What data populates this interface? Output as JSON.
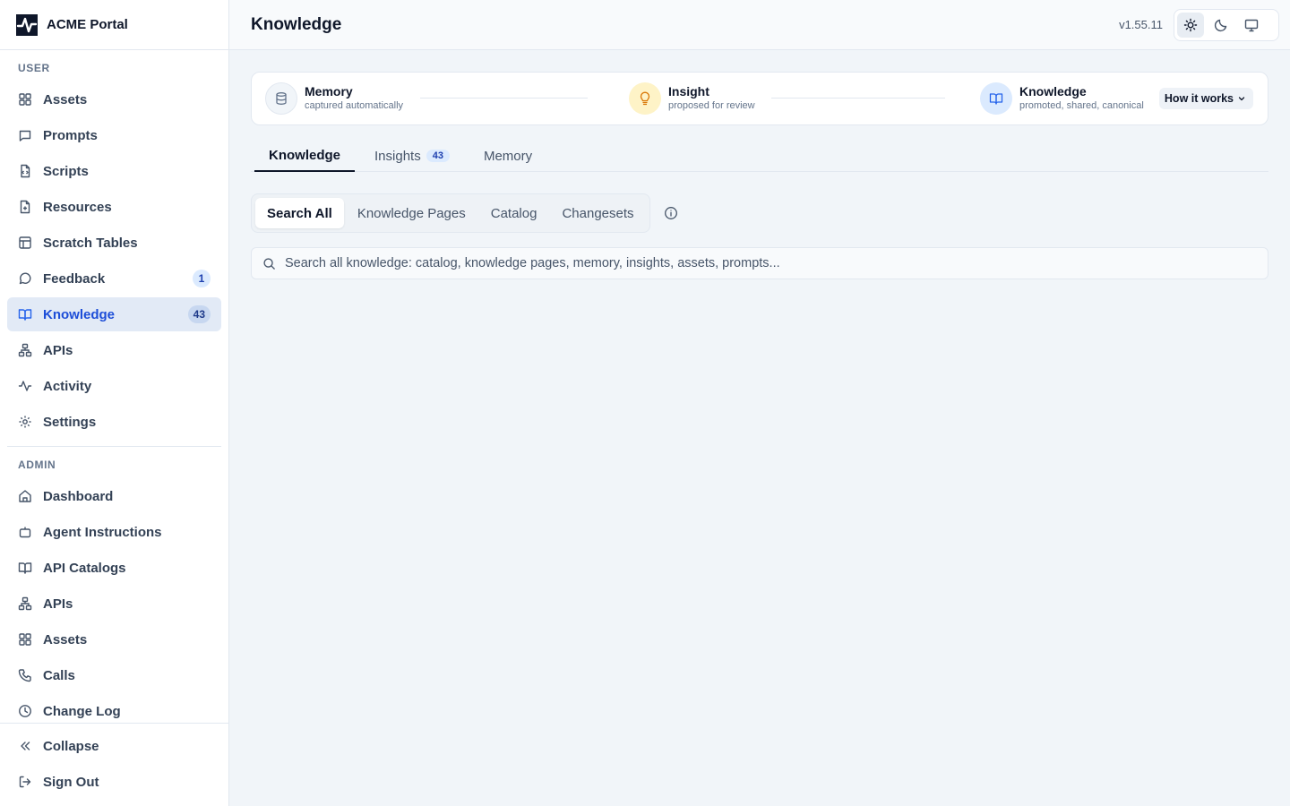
{
  "app": {
    "name": "ACME Portal"
  },
  "sidebar": {
    "user_title": "USER",
    "admin_title": "ADMIN",
    "user_items": [
      {
        "label": "Assets",
        "icon": "grid-icon"
      },
      {
        "label": "Prompts",
        "icon": "message-square-icon"
      },
      {
        "label": "Scripts",
        "icon": "file-code-icon"
      },
      {
        "label": "Resources",
        "icon": "file-plus-icon"
      },
      {
        "label": "Scratch Tables",
        "icon": "table-icon"
      },
      {
        "label": "Feedback",
        "icon": "message-circle-icon",
        "badge": "1"
      },
      {
        "label": "Knowledge",
        "icon": "book-open-icon",
        "badge": "43",
        "active": true
      },
      {
        "label": "APIs",
        "icon": "network-icon"
      },
      {
        "label": "Activity",
        "icon": "activity-icon"
      },
      {
        "label": "Settings",
        "icon": "gear-icon"
      }
    ],
    "admin_items": [
      {
        "label": "Dashboard",
        "icon": "home-icon"
      },
      {
        "label": "Agent Instructions",
        "icon": "bot-icon"
      },
      {
        "label": "API Catalogs",
        "icon": "book-open-icon"
      },
      {
        "label": "APIs",
        "icon": "network-icon"
      },
      {
        "label": "Assets",
        "icon": "grid-icon"
      },
      {
        "label": "Calls",
        "icon": "phone-icon"
      },
      {
        "label": "Change Log",
        "icon": "clock-icon"
      }
    ],
    "collapse_label": "Collapse",
    "signout_label": "Sign Out"
  },
  "header": {
    "title": "Knowledge",
    "version": "v1.55.11",
    "theme_options": [
      "light",
      "dark",
      "system"
    ],
    "theme_selected": "light"
  },
  "pipeline": {
    "stages": [
      {
        "title": "Memory",
        "subtitle": "captured automatically",
        "icon": "database-icon",
        "color": "#f1f5f9"
      },
      {
        "title": "Insight",
        "subtitle": "proposed for review",
        "icon": "lightbulb-icon",
        "color": "#fef3c7"
      },
      {
        "title": "Knowledge",
        "subtitle": "promoted, shared, canonical",
        "icon": "book-open-icon",
        "color": "#dbeafe"
      }
    ],
    "how_it_works": "How it works"
  },
  "tabs": [
    {
      "label": "Knowledge",
      "active": true
    },
    {
      "label": "Insights",
      "badge": "43"
    },
    {
      "label": "Memory"
    }
  ],
  "subtabs": [
    {
      "label": "Search All",
      "active": true
    },
    {
      "label": "Knowledge Pages"
    },
    {
      "label": "Catalog"
    },
    {
      "label": "Changesets"
    }
  ],
  "search": {
    "placeholder": "Search all knowledge: catalog, knowledge pages, memory, insights, assets, prompts...",
    "value": ""
  },
  "colors": {
    "accent": "#2563eb",
    "active_bg": "#e2eaf6",
    "badge_bg": "#dbeafe"
  }
}
